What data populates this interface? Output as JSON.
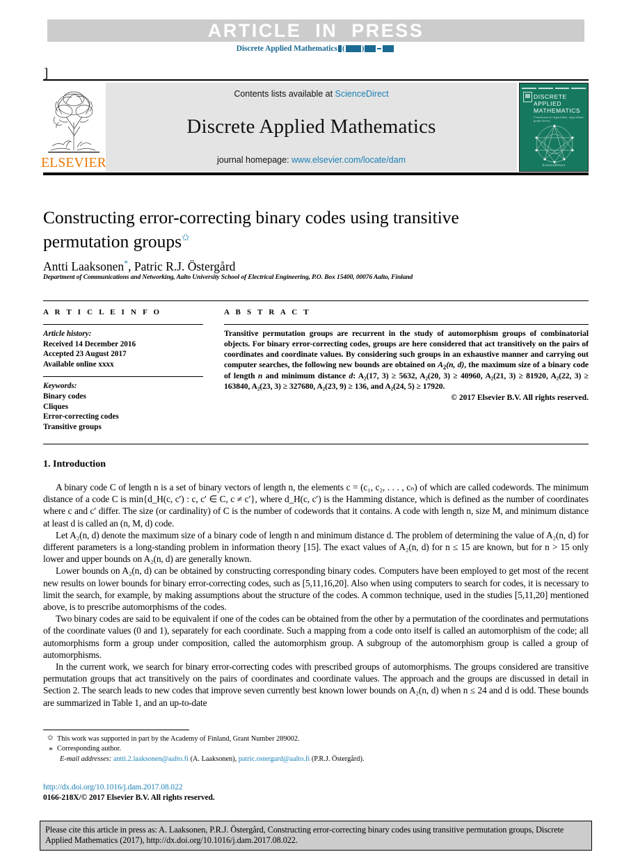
{
  "banner": {
    "label": "ARTICLE  IN  PRESS"
  },
  "running_head": {
    "journal": "Discrete Applied Mathematics"
  },
  "bracket_mark": "]",
  "masthead": {
    "contents_prefix": "Contents lists available at ",
    "contents_link": "ScienceDirect",
    "journal_name": "Discrete Applied Mathematics",
    "homepage_prefix": "journal homepage: ",
    "homepage_link": "www.elsevier.com/locate/dam",
    "publisher_logo_text": "ELSEVIER",
    "cover": {
      "title_line1": "DISCRETE",
      "title_line2": "APPLIED",
      "title_line3": "MATHEMATICS",
      "subtitle": "Combinatorial algorithms, algorithmic graph theory",
      "footer": "ScienceDirect"
    }
  },
  "article": {
    "title": "Constructing error-correcting binary codes using transitive permutation groups",
    "title_star": "✩",
    "authors": "Antti Laaksonen",
    "authors_sep": ", Patric R.J. Östergård",
    "author_mark": "*",
    "affiliation": "Department of Communications and Networking, Aalto University School of Electrical Engineering, P.O. Box 15400, 00076 Aalto, Finland"
  },
  "info": {
    "heading": "A R T I C L E   I N F O",
    "history_label": "Article history:",
    "history": [
      "Received 14 December 2016",
      "Accepted 23 August 2017",
      "Available online xxxx"
    ],
    "keywords_label": "Keywords:",
    "keywords": [
      "Binary codes",
      "Cliques",
      "Error-correcting codes",
      "Transitive groups"
    ]
  },
  "abstract": {
    "heading": "A B S T R A C T",
    "text_part1": "Transitive permutation groups are recurrent in the study of automorphism groups of combinatorial objects. For binary error-correcting codes, groups are here considered that act transitively on the pairs of coordinates and coordinate values. By considering such groups in an exhaustive manner and carrying out computer searches, the following new bounds are obtained on ",
    "a2nd": "A",
    "a2nd_sub": "2",
    "a2nd_args": "(n, d)",
    "text_part2": ", the maximum size of a binary code of length ",
    "n_italic": "n",
    "text_part3": " and minimum distance ",
    "d_italic": "d",
    "bounds": ": A₂(17, 3) ≥ 5632, A₂(20, 3) ≥ 40960, A₂(21, 3) ≥ 81920, A₂(22, 3) ≥ 163840, A₂(23, 3) ≥ 327680, A₂(23, 9) ≥ 136, and A₂(24, 5) ≥ 17920.",
    "copyright": "© 2017 Elsevier B.V. All rights reserved."
  },
  "section": {
    "number_title": "1. Introduction"
  },
  "body": {
    "p1": "A binary code C of length n is a set of binary vectors of length n, the elements c = (c₁, c₂, . . . , cₙ) of which are called codewords. The minimum distance of a code C is min{d_H(c, c′) : c, c′ ∈ C, c ≠ c′}, where d_H(c, c′) is the Hamming distance, which is defined as the number of coordinates where c and c′ differ. The size (or cardinality) of C is the number of codewords that it contains. A code with length n, size M, and minimum distance at least d is called an (n, M, d) code.",
    "p2": "Let A₂(n, d) denote the maximum size of a binary code of length n and minimum distance d. The problem of determining the value of A₂(n, d) for different parameters is a long-standing problem in information theory [15]. The exact values of A₂(n, d) for n ≤ 15 are known, but for n > 15 only lower and upper bounds on A₂(n, d) are generally known.",
    "p3": "Lower bounds on A₂(n, d) can be obtained by constructing corresponding binary codes. Computers have been employed to get most of the recent new results on lower bounds for binary error-correcting codes, such as [5,11,16,20]. Also when using computers to search for codes, it is necessary to limit the search, for example, by making assumptions about the structure of the codes. A common technique, used in the studies [5,11,20] mentioned above, is to prescribe automorphisms of the codes.",
    "p4": "Two binary codes are said to be equivalent if one of the codes can be obtained from the other by a permutation of the coordinates and permutations of the coordinate values (0 and 1), separately for each coordinate. Such a mapping from a code onto itself is called an automorphism of the code; all automorphisms form a group under composition, called the automorphism group. A subgroup of the automorphism group is called a group of automorphisms.",
    "p5": "In the current work, we search for binary error-correcting codes with prescribed groups of automorphisms. The groups considered are transitive permutation groups that act transitively on the pairs of coordinates and coordinate values. The approach and the groups are discussed in detail in Section 2. The search leads to new codes that improve seven currently best known lower bounds on A₂(n, d) when n ≤ 24 and d is odd. These bounds are summarized in Table 1, and an up-to-date"
  },
  "footnotes": {
    "funding_mark": "✩",
    "funding": "This work was supported in part by the Academy of Finland, Grant Number 289002.",
    "corresponding_mark": "*",
    "corresponding": "Corresponding author.",
    "email_label": "E-mail addresses:",
    "email1": "antti.2.laaksonen@aalto.fi",
    "email1_who": "(A. Laaksonen),",
    "email2": "patric.ostergard@aalto.fi",
    "email2_who": "(P.R.J. Östergård)."
  },
  "doi": "http://dx.doi.org/10.1016/j.dam.2017.08.022",
  "issn": "0166-218X/© 2017 Elsevier B.V. All rights reserved.",
  "cite_box": {
    "text": "Please cite this article in press as: A. Laaksonen, P.R.J. Östergård, Constructing error-correcting binary codes using transitive permutation groups, Discrete Applied Mathematics (2017), http://dx.doi.org/10.1016/j.dam.2017.08.022."
  },
  "colors": {
    "link": "#1a7fb5",
    "banner_bg": "#cccccc",
    "banner_text": "#ffffff",
    "journal_head": "#1a6a92",
    "elsevier_orange": "#ea7600",
    "cover_green": "#16795f"
  }
}
